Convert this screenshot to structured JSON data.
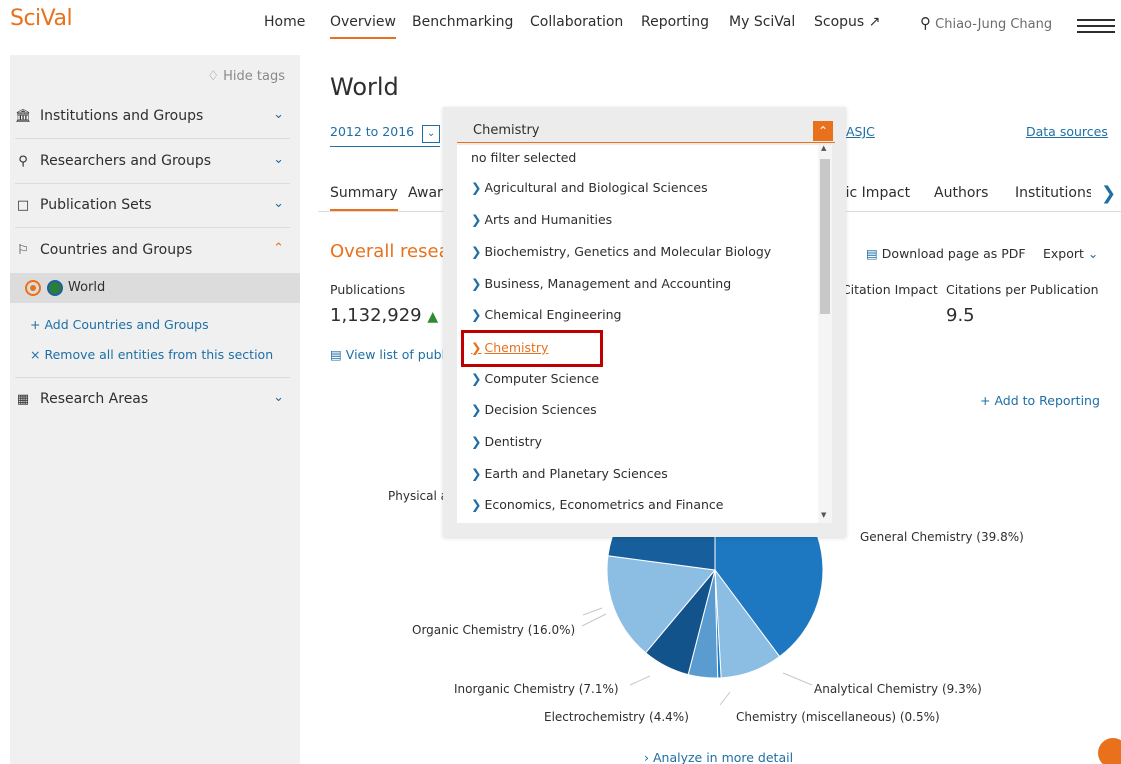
{
  "app": {
    "logo": "SciVal"
  },
  "nav": {
    "items": [
      {
        "label": "Home"
      },
      {
        "label": "Overview"
      },
      {
        "label": "Benchmarking"
      },
      {
        "label": "Collaboration"
      },
      {
        "label": "Reporting"
      },
      {
        "label": "My SciVal"
      },
      {
        "label": "Scopus ↗"
      }
    ],
    "active": "Overview",
    "user": "Chiao-Jung Chang"
  },
  "sidebar": {
    "hide_tags": "Hide tags",
    "sections": [
      {
        "label": "Institutions and Groups",
        "icon": "institution-icon",
        "expanded": false
      },
      {
        "label": "Researchers and Groups",
        "icon": "person-icon",
        "expanded": false
      },
      {
        "label": "Publication Sets",
        "icon": "document-icon",
        "expanded": false
      },
      {
        "label": "Countries and Groups",
        "icon": "flag-icon",
        "expanded": true
      },
      {
        "label": "Research Areas",
        "icon": "grid-icon",
        "expanded": false
      }
    ],
    "selected_entity": "World",
    "add_link": "+ Add Countries and Groups",
    "remove_link": "× Remove all entities from this section"
  },
  "main": {
    "title": "World",
    "year_range": "2012 to 2016",
    "classification_link": "ASJC",
    "data_sources": "Data sources",
    "tabs": [
      "Summary",
      "Awar",
      "mic Impact",
      "Authors",
      "Institutions"
    ],
    "section_title": "Overall resear",
    "download_pdf": "Download page as PDF",
    "export": "Export",
    "publications_label": "Publications",
    "publications_value": "1,132,929",
    "citation_impact_label": "d Citation Impact",
    "citations_per_pub_label": "Citations per Publication",
    "citations_per_pub_value": "9.5",
    "view_list": "View list of publica",
    "add_to_reporting": "+ Add to Reporting",
    "analyze_more": "Analyze in more detail"
  },
  "dropdown": {
    "selected": "Chemistry",
    "items": [
      "no filter selected",
      "Agricultural and Biological Sciences",
      "Arts and Humanities",
      "Biochemistry, Genetics and Molecular Biology",
      "Business, Management and Accounting",
      "Chemical Engineering",
      "Chemistry",
      "Computer Science",
      "Decision Sciences",
      "Dentistry",
      "Earth and Planetary Sciences",
      "Economics, Econometrics and Finance"
    ]
  },
  "chart_data": {
    "type": "pie",
    "title": "",
    "slices": [
      {
        "label": "General Chemistry (39.8%)",
        "value": 39.8,
        "color": "#1d78c1"
      },
      {
        "label": "Analytical Chemistry (9.3%)",
        "value": 9.3,
        "color": "#8cbde3"
      },
      {
        "label": "Chemistry (miscellaneous) (0.5%)",
        "value": 0.5,
        "color": "#1d78c1"
      },
      {
        "label": "Electrochemistry (4.4%)",
        "value": 4.4,
        "color": "#5a9bd0"
      },
      {
        "label": "Inorganic Chemistry (7.1%)",
        "value": 7.1,
        "color": "#11538a"
      },
      {
        "label": "Organic Chemistry (16.0%)",
        "value": 16.0,
        "color": "#8cbde3"
      },
      {
        "label": "Physical and Theoretical Chemistry",
        "value": 22.9,
        "color": "#175f9c"
      }
    ],
    "visible_labels": {
      "physical": "Physical a"
    }
  }
}
